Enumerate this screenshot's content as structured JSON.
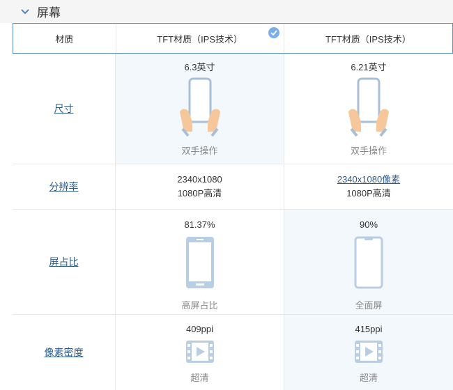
{
  "section": {
    "title": "屏幕",
    "chevron": "chevron-down-icon"
  },
  "header": {
    "label": "材质",
    "col1": "TFT材质（IPS技术）",
    "col2": "TFT材质（IPS技术）",
    "selected_icon": "check-circle-icon"
  },
  "size": {
    "label": "尺寸",
    "col1": {
      "value": "6.3英寸",
      "caption": "双手操作"
    },
    "col2": {
      "value": "6.21英寸",
      "caption": "双手操作"
    }
  },
  "resolution": {
    "label": "分辨率",
    "col1": {
      "line1": "2340x1080",
      "line2": "1080P高清"
    },
    "col2": {
      "line1": "2340x1080像素",
      "line2": "1080P高清"
    }
  },
  "ratio": {
    "label": "屏占比",
    "col1": {
      "value": "81.37%",
      "caption": "高屏占比"
    },
    "col2": {
      "value": "90%",
      "caption": "全面屏"
    }
  },
  "density": {
    "label": "像素密度",
    "col1": {
      "value": "409ppi",
      "caption": "超清"
    },
    "col2": {
      "value": "415ppi",
      "caption": "超清"
    }
  },
  "colors": {
    "accent": "#7aaeea",
    "link": "#2d5c8c",
    "highlight": "#f3f8fd",
    "icon_blue": "#b9cde3",
    "hand": "#f6c79a"
  }
}
